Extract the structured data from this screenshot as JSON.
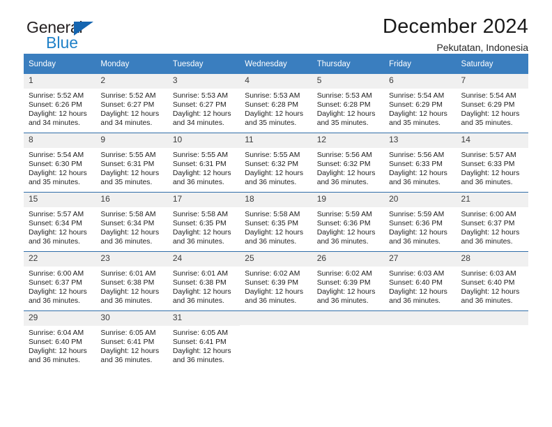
{
  "brand": {
    "name_part1": "General",
    "name_part2": "Blue",
    "triangle_color": "#1565b0",
    "blue_color": "#2081c8"
  },
  "header": {
    "title": "December 2024",
    "location": "Pekutatan, Indonesia"
  },
  "calendar": {
    "accent_color": "#3a7ebf",
    "weekday_headers": [
      "Sunday",
      "Monday",
      "Tuesday",
      "Wednesday",
      "Thursday",
      "Friday",
      "Saturday"
    ],
    "weeks": [
      [
        {
          "day": "1",
          "sunrise": "Sunrise: 5:52 AM",
          "sunset": "Sunset: 6:26 PM",
          "daylight1": "Daylight: 12 hours",
          "daylight2": "and 34 minutes."
        },
        {
          "day": "2",
          "sunrise": "Sunrise: 5:52 AM",
          "sunset": "Sunset: 6:27 PM",
          "daylight1": "Daylight: 12 hours",
          "daylight2": "and 34 minutes."
        },
        {
          "day": "3",
          "sunrise": "Sunrise: 5:53 AM",
          "sunset": "Sunset: 6:27 PM",
          "daylight1": "Daylight: 12 hours",
          "daylight2": "and 34 minutes."
        },
        {
          "day": "4",
          "sunrise": "Sunrise: 5:53 AM",
          "sunset": "Sunset: 6:28 PM",
          "daylight1": "Daylight: 12 hours",
          "daylight2": "and 35 minutes."
        },
        {
          "day": "5",
          "sunrise": "Sunrise: 5:53 AM",
          "sunset": "Sunset: 6:28 PM",
          "daylight1": "Daylight: 12 hours",
          "daylight2": "and 35 minutes."
        },
        {
          "day": "6",
          "sunrise": "Sunrise: 5:54 AM",
          "sunset": "Sunset: 6:29 PM",
          "daylight1": "Daylight: 12 hours",
          "daylight2": "and 35 minutes."
        },
        {
          "day": "7",
          "sunrise": "Sunrise: 5:54 AM",
          "sunset": "Sunset: 6:29 PM",
          "daylight1": "Daylight: 12 hours",
          "daylight2": "and 35 minutes."
        }
      ],
      [
        {
          "day": "8",
          "sunrise": "Sunrise: 5:54 AM",
          "sunset": "Sunset: 6:30 PM",
          "daylight1": "Daylight: 12 hours",
          "daylight2": "and 35 minutes."
        },
        {
          "day": "9",
          "sunrise": "Sunrise: 5:55 AM",
          "sunset": "Sunset: 6:31 PM",
          "daylight1": "Daylight: 12 hours",
          "daylight2": "and 35 minutes."
        },
        {
          "day": "10",
          "sunrise": "Sunrise: 5:55 AM",
          "sunset": "Sunset: 6:31 PM",
          "daylight1": "Daylight: 12 hours",
          "daylight2": "and 36 minutes."
        },
        {
          "day": "11",
          "sunrise": "Sunrise: 5:55 AM",
          "sunset": "Sunset: 6:32 PM",
          "daylight1": "Daylight: 12 hours",
          "daylight2": "and 36 minutes."
        },
        {
          "day": "12",
          "sunrise": "Sunrise: 5:56 AM",
          "sunset": "Sunset: 6:32 PM",
          "daylight1": "Daylight: 12 hours",
          "daylight2": "and 36 minutes."
        },
        {
          "day": "13",
          "sunrise": "Sunrise: 5:56 AM",
          "sunset": "Sunset: 6:33 PM",
          "daylight1": "Daylight: 12 hours",
          "daylight2": "and 36 minutes."
        },
        {
          "day": "14",
          "sunrise": "Sunrise: 5:57 AM",
          "sunset": "Sunset: 6:33 PM",
          "daylight1": "Daylight: 12 hours",
          "daylight2": "and 36 minutes."
        }
      ],
      [
        {
          "day": "15",
          "sunrise": "Sunrise: 5:57 AM",
          "sunset": "Sunset: 6:34 PM",
          "daylight1": "Daylight: 12 hours",
          "daylight2": "and 36 minutes."
        },
        {
          "day": "16",
          "sunrise": "Sunrise: 5:58 AM",
          "sunset": "Sunset: 6:34 PM",
          "daylight1": "Daylight: 12 hours",
          "daylight2": "and 36 minutes."
        },
        {
          "day": "17",
          "sunrise": "Sunrise: 5:58 AM",
          "sunset": "Sunset: 6:35 PM",
          "daylight1": "Daylight: 12 hours",
          "daylight2": "and 36 minutes."
        },
        {
          "day": "18",
          "sunrise": "Sunrise: 5:58 AM",
          "sunset": "Sunset: 6:35 PM",
          "daylight1": "Daylight: 12 hours",
          "daylight2": "and 36 minutes."
        },
        {
          "day": "19",
          "sunrise": "Sunrise: 5:59 AM",
          "sunset": "Sunset: 6:36 PM",
          "daylight1": "Daylight: 12 hours",
          "daylight2": "and 36 minutes."
        },
        {
          "day": "20",
          "sunrise": "Sunrise: 5:59 AM",
          "sunset": "Sunset: 6:36 PM",
          "daylight1": "Daylight: 12 hours",
          "daylight2": "and 36 minutes."
        },
        {
          "day": "21",
          "sunrise": "Sunrise: 6:00 AM",
          "sunset": "Sunset: 6:37 PM",
          "daylight1": "Daylight: 12 hours",
          "daylight2": "and 36 minutes."
        }
      ],
      [
        {
          "day": "22",
          "sunrise": "Sunrise: 6:00 AM",
          "sunset": "Sunset: 6:37 PM",
          "daylight1": "Daylight: 12 hours",
          "daylight2": "and 36 minutes."
        },
        {
          "day": "23",
          "sunrise": "Sunrise: 6:01 AM",
          "sunset": "Sunset: 6:38 PM",
          "daylight1": "Daylight: 12 hours",
          "daylight2": "and 36 minutes."
        },
        {
          "day": "24",
          "sunrise": "Sunrise: 6:01 AM",
          "sunset": "Sunset: 6:38 PM",
          "daylight1": "Daylight: 12 hours",
          "daylight2": "and 36 minutes."
        },
        {
          "day": "25",
          "sunrise": "Sunrise: 6:02 AM",
          "sunset": "Sunset: 6:39 PM",
          "daylight1": "Daylight: 12 hours",
          "daylight2": "and 36 minutes."
        },
        {
          "day": "26",
          "sunrise": "Sunrise: 6:02 AM",
          "sunset": "Sunset: 6:39 PM",
          "daylight1": "Daylight: 12 hours",
          "daylight2": "and 36 minutes."
        },
        {
          "day": "27",
          "sunrise": "Sunrise: 6:03 AM",
          "sunset": "Sunset: 6:40 PM",
          "daylight1": "Daylight: 12 hours",
          "daylight2": "and 36 minutes."
        },
        {
          "day": "28",
          "sunrise": "Sunrise: 6:03 AM",
          "sunset": "Sunset: 6:40 PM",
          "daylight1": "Daylight: 12 hours",
          "daylight2": "and 36 minutes."
        }
      ],
      [
        {
          "day": "29",
          "sunrise": "Sunrise: 6:04 AM",
          "sunset": "Sunset: 6:40 PM",
          "daylight1": "Daylight: 12 hours",
          "daylight2": "and 36 minutes."
        },
        {
          "day": "30",
          "sunrise": "Sunrise: 6:05 AM",
          "sunset": "Sunset: 6:41 PM",
          "daylight1": "Daylight: 12 hours",
          "daylight2": "and 36 minutes."
        },
        {
          "day": "31",
          "sunrise": "Sunrise: 6:05 AM",
          "sunset": "Sunset: 6:41 PM",
          "daylight1": "Daylight: 12 hours",
          "daylight2": "and 36 minutes."
        },
        {
          "day": "",
          "sunrise": "",
          "sunset": "",
          "daylight1": "",
          "daylight2": ""
        },
        {
          "day": "",
          "sunrise": "",
          "sunset": "",
          "daylight1": "",
          "daylight2": ""
        },
        {
          "day": "",
          "sunrise": "",
          "sunset": "",
          "daylight1": "",
          "daylight2": ""
        },
        {
          "day": "",
          "sunrise": "",
          "sunset": "",
          "daylight1": "",
          "daylight2": ""
        }
      ]
    ]
  }
}
